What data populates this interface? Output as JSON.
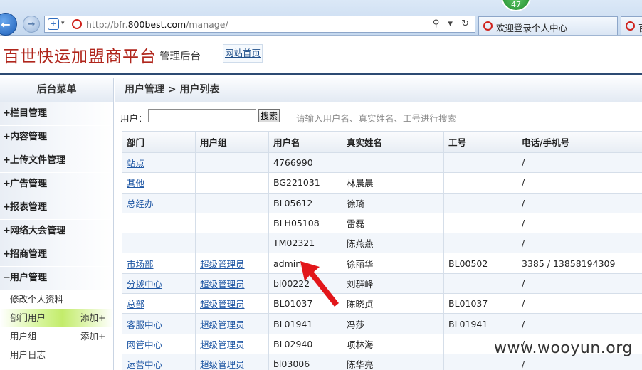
{
  "browser": {
    "url_prefix": "http://bfr.",
    "url_domain": "800best.com",
    "url_path": "/manage/",
    "toolbar_glyphs": "⚲ ▾ ↻",
    "tabs": [
      {
        "label": "欢迎登录个人中心"
      },
      {
        "label": "百世"
      }
    ],
    "badge": "47"
  },
  "header": {
    "title": "百世快运加盟商平台",
    "subtitle": "管理后台",
    "home_link": "网站首页"
  },
  "sidebar": {
    "title": "后台菜单",
    "items": [
      {
        "sign": "+",
        "label": "栏目管理"
      },
      {
        "sign": "+",
        "label": "内容管理"
      },
      {
        "sign": "+",
        "label": "上传文件管理"
      },
      {
        "sign": "+",
        "label": "广告管理"
      },
      {
        "sign": "+",
        "label": "报表管理"
      },
      {
        "sign": "+",
        "label": "网络大会管理"
      },
      {
        "sign": "+",
        "label": "招商管理"
      },
      {
        "sign": "−",
        "label": "用户管理"
      }
    ],
    "sub_items": [
      {
        "label": "修改个人资料",
        "add": ""
      },
      {
        "label": "部门用户",
        "add": "添加+"
      },
      {
        "label": "用户组",
        "add": "添加+"
      },
      {
        "label": "用户日志",
        "add": ""
      }
    ]
  },
  "main": {
    "breadcrumb": "用户管理 > 用户列表",
    "search": {
      "label": "用户：",
      "value": "",
      "button": "搜索",
      "hint": "请输入用户名、真实姓名、工号进行搜索"
    },
    "table": {
      "headers": [
        "部门",
        "用户组",
        "用户名",
        "真实姓名",
        "工号",
        "电话/手机号"
      ],
      "rows": [
        [
          "站点",
          "",
          "4766990",
          "",
          "",
          "/"
        ],
        [
          "其他",
          "",
          "BG221031",
          "林晨晨",
          "",
          "/"
        ],
        [
          "总经办",
          "",
          "BL05612",
          "徐琦",
          "",
          "/"
        ],
        [
          "",
          "",
          "BLH05108",
          "雷磊",
          "",
          "/"
        ],
        [
          "",
          "",
          "TM02321",
          "陈燕燕",
          "",
          "/"
        ],
        [
          "市场部",
          "超级管理员",
          "admin",
          "徐丽华",
          "BL00502",
          "3385 / 13858194309"
        ],
        [
          "分拨中心",
          "超级管理员",
          "bl00222",
          "刘群峰",
          "",
          "/"
        ],
        [
          "总部",
          "超级管理员",
          "BL01037",
          "陈晓贞",
          "BL01037",
          "/"
        ],
        [
          "客服中心",
          "超级管理员",
          "BL01941",
          "冯莎",
          "BL01941",
          "/"
        ],
        [
          "网管中心",
          "超级管理员",
          "BL02940",
          "项林海",
          "",
          "/"
        ],
        [
          "运营中心",
          "超级管理员",
          "bl03006",
          "陈华亮",
          "",
          "/"
        ]
      ]
    }
  },
  "watermark": "www.wooyun.org",
  "colors": {
    "title_red": "#b0261c",
    "header_bar": "#2d4a73",
    "link_blue": "#1f57a4",
    "arrow_red": "#e2161a"
  }
}
